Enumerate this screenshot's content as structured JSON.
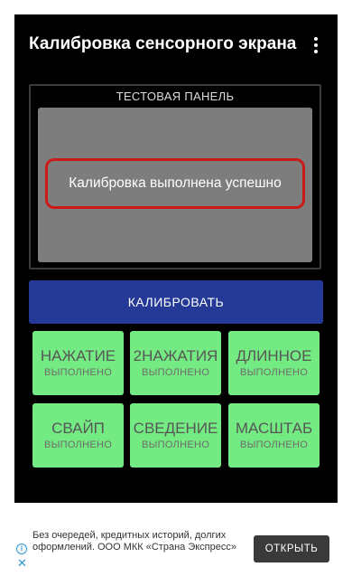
{
  "app": {
    "title": "Калибровка сенсорного экрана",
    "menu_icon": "more-vert-icon"
  },
  "test_panel": {
    "title": "ТЕСТОВАЯ ПАНЕЛЬ",
    "result_message": "Калибровка выполнена успешно"
  },
  "calibrate_button": {
    "label": "КАЛИБРОВАТЬ"
  },
  "tests": [
    {
      "title": "НАЖАТИЕ",
      "status": "ВЫПОЛНЕНО"
    },
    {
      "title": "2НАЖАТИЯ",
      "status": "ВЫПОЛНЕНО"
    },
    {
      "title": "ДЛИННОЕ",
      "status": "ВЫПОЛНЕНО"
    },
    {
      "title": "СВАЙП",
      "status": "ВЫПОЛНЕНО"
    },
    {
      "title": "СВЕДЕНИЕ",
      "status": "ВЫПОЛНЕНО"
    },
    {
      "title": "МАСШТАБ",
      "status": "ВЫПОЛНЕНО"
    }
  ],
  "ad": {
    "text": "Без очередей, кредитных историй, долгих оформлений. ООО МКК «Страна Экспресс»",
    "button_label": "ОТКРЫТЬ"
  },
  "colors": {
    "background": "#000000",
    "calibrate_button": "#253a96",
    "tile_done": "#74ea82",
    "highlight": "#cc1a1a"
  }
}
